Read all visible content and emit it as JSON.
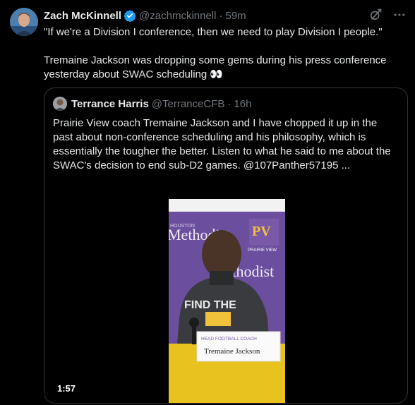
{
  "tweet": {
    "author_name": "Zach McKinnell",
    "author_handle": "@zachmckinnell",
    "separator": "·",
    "time": "59m",
    "text_line1": "\"If we're a Division I conference, then we need to play Division I people.\"",
    "text_line2": "Tremaine Jackson was dropping some gems during his press conference yesterday about SWAC scheduling 👀"
  },
  "quoted_tweet": {
    "author_name": "Terrance Harris",
    "author_handle": "@TerranceCFB",
    "separator": "·",
    "time": "16h",
    "text": "Prairie View coach Tremaine Jackson and I have chopped it up in the past about non-conference scheduling and his philosophy, which is essentially the tougher the better. Listen to what he said to me about the SWAC's decision to end sub-D2 games. @107Panther57195 ...",
    "video_duration": "1:57"
  },
  "video_overlay": {
    "backdrop_text": "Methodist",
    "backdrop_small": "HOUSTON",
    "logo_text": "PV",
    "logo_sub": "PRAIRIE VIEW",
    "shirt_text": "FIND THE",
    "nameplate_title": "HEAD FOOTBALL COACH",
    "nameplate_name": "Tremaine Jackson"
  },
  "icons": {
    "verified": "verified-badge-icon",
    "grok": "grok-icon",
    "more": "more-icon"
  },
  "colors": {
    "background": "#000000",
    "text": "#e7e9ea",
    "muted": "#71767b",
    "verified": "#1d9bf0",
    "border": "#2f3336"
  }
}
